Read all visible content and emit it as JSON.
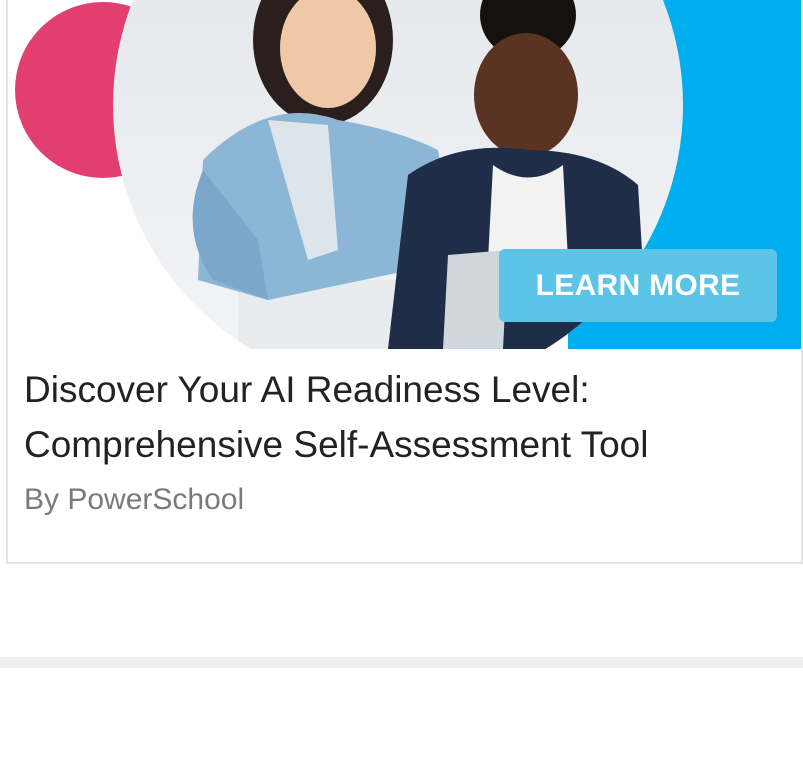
{
  "ad": {
    "cta_label": "LEARN MORE",
    "title_lines": [
      "Discover Your AI Readiness Level:",
      "Comprehensive Self-Assessment Tool"
    ],
    "byline": "By PowerSchool",
    "colors": {
      "accent_cyan": "#00aeef",
      "accent_pink": "#e23e6f",
      "cta_background": "#5cc4e6",
      "title_text": "#222222",
      "byline_text": "#7a7a7a"
    },
    "hero_image": "photo of two smiling women looking at a laptop, with pink circle and cyan background shapes"
  }
}
